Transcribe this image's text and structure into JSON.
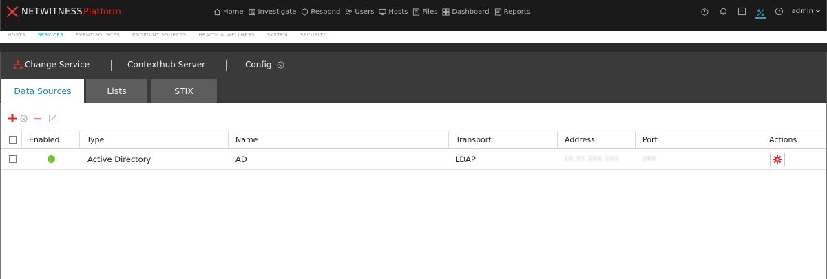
{
  "brand": {
    "name": "NETWITNESS",
    "product": "Platform"
  },
  "main_nav": [
    {
      "label": "Home",
      "icon": "home-icon"
    },
    {
      "label": "Investigate",
      "icon": "investigate-icon"
    },
    {
      "label": "Respond",
      "icon": "respond-icon"
    },
    {
      "label": "Users",
      "icon": "users-icon"
    },
    {
      "label": "Hosts",
      "icon": "hosts-icon"
    },
    {
      "label": "Files",
      "icon": "files-icon"
    },
    {
      "label": "Dashboard",
      "icon": "dashboard-icon"
    },
    {
      "label": "Reports",
      "icon": "reports-icon"
    }
  ],
  "user": {
    "name": "admin"
  },
  "sub_nav": [
    {
      "label": "HOSTS"
    },
    {
      "label": "SERVICES",
      "active": true
    },
    {
      "label": "EVENT SOURCES"
    },
    {
      "label": "ENDPOINT SOURCES"
    },
    {
      "label": "HEALTH & WELLNESS"
    },
    {
      "label": "SYSTEM"
    },
    {
      "label": "SECURITY"
    }
  ],
  "context": {
    "change_service": "Change Service",
    "server": "Contexthub Server",
    "config": "Config"
  },
  "tabs": [
    {
      "label": "Data Sources",
      "active": true
    },
    {
      "label": "Lists"
    },
    {
      "label": "STIX"
    }
  ],
  "table": {
    "columns": [
      "Enabled",
      "Type",
      "Name",
      "Transport",
      "Address",
      "Port",
      "Actions"
    ],
    "rows": [
      {
        "type": "Active Directory",
        "name": "AD",
        "transport": "LDAP",
        "address": "10.31.204.102",
        "port": "389"
      }
    ]
  },
  "colors": {
    "accent": "#22a6b3",
    "brand_red": "#c8281f",
    "enabled_green": "#73c231",
    "action_red": "#d0312d"
  }
}
